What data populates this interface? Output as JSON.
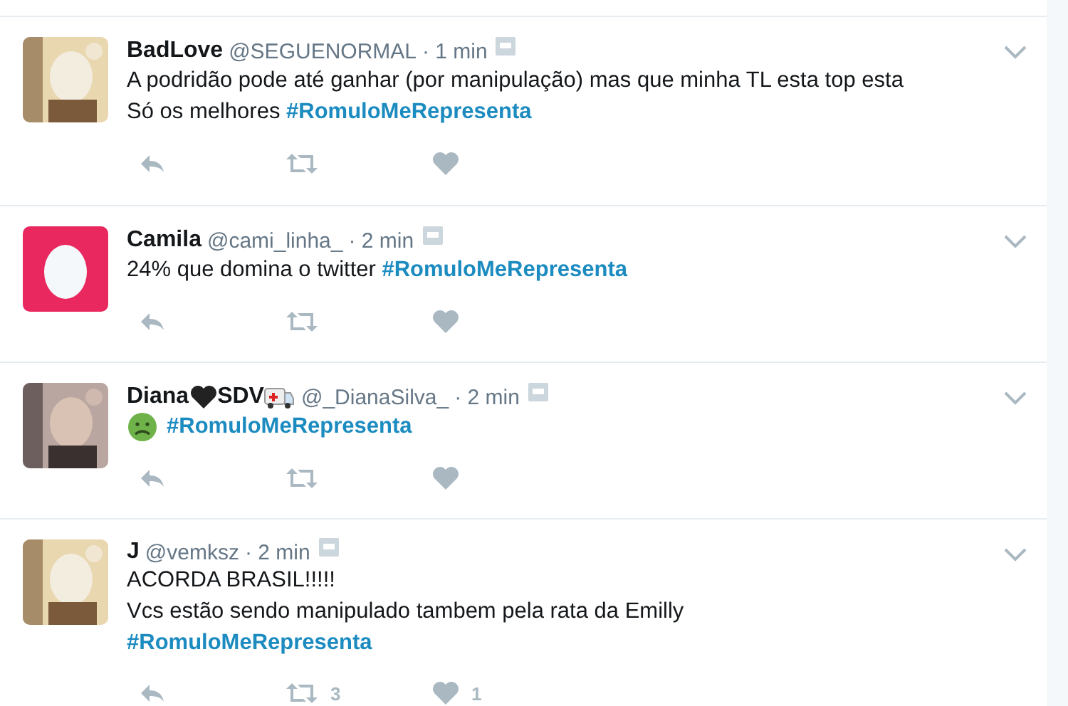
{
  "tweets": [
    {
      "avatar": {
        "kind": "picture"
      },
      "name_parts": [
        {
          "kind": "text",
          "text": "BadLove"
        }
      ],
      "handle": "@SEGUENORMAL",
      "time": "· 1 min",
      "lines": [
        {
          "text": "A podridão pode até ganhar (por manipulação) mas que minha TL esta top esta"
        },
        {
          "text": "Só os melhores ",
          "hashtag": "#RomuloMeRepresenta"
        }
      ],
      "actions": [
        {
          "kind": "reply"
        },
        {
          "kind": "retweet"
        },
        {
          "kind": "like"
        }
      ]
    },
    {
      "avatar": {
        "kind": "egg"
      },
      "name_parts": [
        {
          "kind": "text",
          "text": "Camila"
        }
      ],
      "handle": "@cami_linha_",
      "time": "· 2 min",
      "lines": [
        {
          "text": "24% que domina o twitter ",
          "hashtag": "#RomuloMeRepresenta"
        }
      ],
      "actions": [
        {
          "kind": "reply"
        },
        {
          "kind": "retweet"
        },
        {
          "kind": "like"
        }
      ]
    },
    {
      "avatar": {
        "kind": "picture"
      },
      "name_parts": [
        {
          "kind": "text",
          "text": "Diana"
        },
        {
          "kind": "heart"
        },
        {
          "kind": "text",
          "text": "SDV"
        },
        {
          "kind": "ambulance"
        }
      ],
      "handle": "@_DianaSilva_",
      "time": "· 2 min",
      "lines": [
        {
          "lead": {
            "kind": "sick-face"
          },
          "hashtag": "#RomuloMeRepresenta"
        }
      ],
      "actions": [
        {
          "kind": "reply"
        },
        {
          "kind": "retweet"
        },
        {
          "kind": "like"
        }
      ]
    },
    {
      "avatar": {
        "kind": "picture"
      },
      "name_parts": [
        {
          "kind": "text",
          "text": "J"
        }
      ],
      "handle": "@vemksz",
      "time": "· 2 min",
      "lines": [
        {
          "text": "ACORDA BRASIL!!!!!"
        },
        {
          "text": "Vcs estão sendo manipulado tambem pela rata da Emilly"
        },
        {
          "hashtag": "#RomuloMeRepresenta"
        }
      ],
      "actions": [
        {
          "kind": "reply"
        },
        {
          "kind": "retweet",
          "count": "3"
        },
        {
          "kind": "like",
          "count": "1"
        }
      ]
    }
  ]
}
